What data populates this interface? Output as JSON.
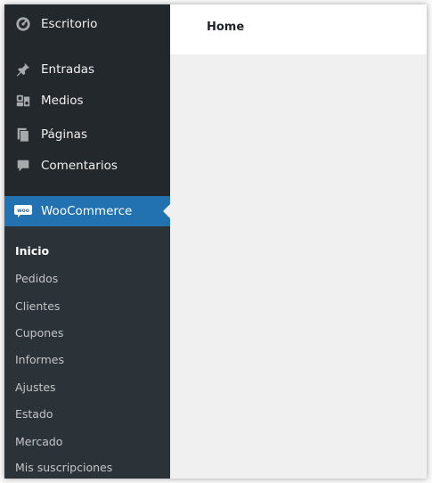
{
  "sidebar": {
    "items": [
      {
        "label": "Escritorio",
        "icon": "dashboard-icon"
      },
      {
        "label": "Entradas",
        "icon": "pin-icon"
      },
      {
        "label": "Medios",
        "icon": "media-icon"
      },
      {
        "label": "Páginas",
        "icon": "pages-icon"
      },
      {
        "label": "Comentarios",
        "icon": "comment-icon"
      },
      {
        "label": "WooCommerce",
        "icon": "woocommerce-icon",
        "badge": "woo"
      }
    ],
    "submenu": [
      "Inicio",
      "Pedidos",
      "Clientes",
      "Cupones",
      "Informes",
      "Ajustes",
      "Estado",
      "Mercado",
      "Mis suscripciones"
    ],
    "current_submenu": "Inicio"
  },
  "header": {
    "title": "Home"
  },
  "colors": {
    "sidebar_bg": "#23282d",
    "submenu_bg": "#2c3338",
    "accent": "#2271b1",
    "content_bg": "#f0f0f1"
  }
}
